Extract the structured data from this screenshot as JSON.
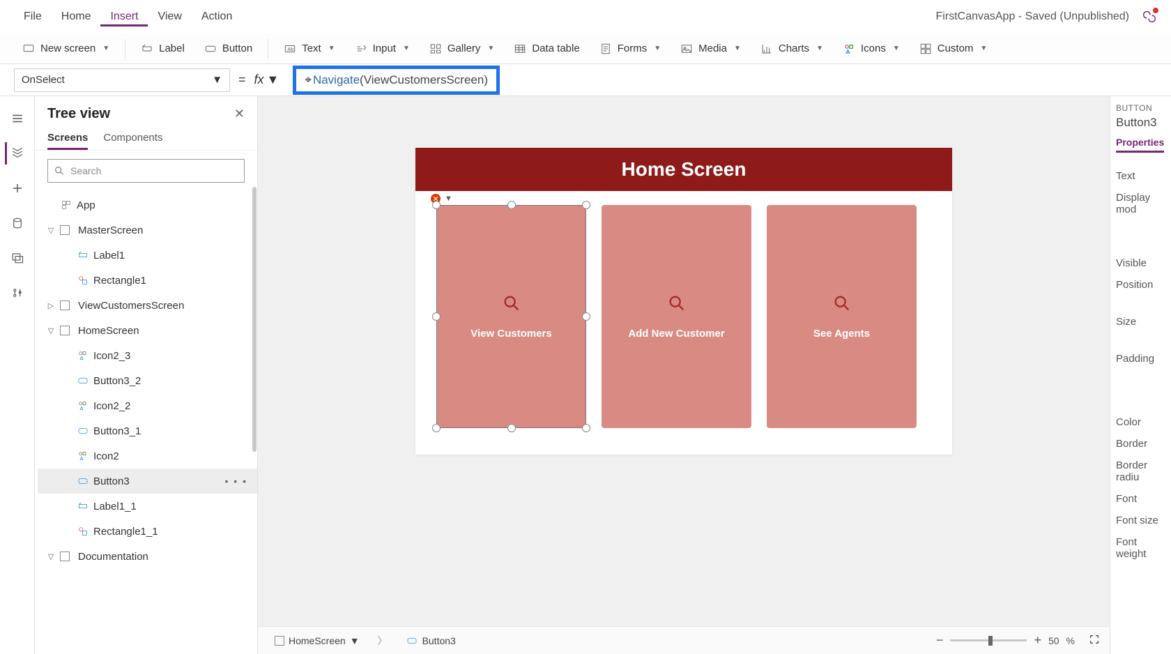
{
  "menubar": {
    "items": [
      "File",
      "Home",
      "Insert",
      "View",
      "Action"
    ],
    "active_index": 2,
    "app_status": "FirstCanvasApp - Saved (Unpublished)"
  },
  "ribbon": {
    "new_screen": "New screen",
    "label": "Label",
    "button": "Button",
    "text": "Text",
    "input": "Input",
    "gallery": "Gallery",
    "data_table": "Data table",
    "forms": "Forms",
    "media": "Media",
    "charts": "Charts",
    "icons": "Icons",
    "custom": "Custom"
  },
  "formula": {
    "property": "OnSelect",
    "equals": "=",
    "fx": "fx",
    "function_name": "Navigate",
    "open": "(",
    "argument": "ViewCustomersScreen",
    "close": ")"
  },
  "treeview": {
    "title": "Tree view",
    "tabs": [
      "Screens",
      "Components"
    ],
    "active_tab": 0,
    "search_placeholder": "Search",
    "nodes": {
      "app": "App",
      "master": "MasterScreen",
      "label1": "Label1",
      "rect1": "Rectangle1",
      "viewcust": "ViewCustomersScreen",
      "home": "HomeScreen",
      "icon2_3": "Icon2_3",
      "button3_2": "Button3_2",
      "icon2_2": "Icon2_2",
      "button3_1": "Button3_1",
      "icon2": "Icon2",
      "button3": "Button3",
      "label1_1": "Label1_1",
      "rect1_1": "Rectangle1_1",
      "doc": "Documentation"
    }
  },
  "canvas": {
    "header_title": "Home Screen",
    "cards": [
      {
        "label": "View Customers"
      },
      {
        "label": "Add New Customer"
      },
      {
        "label": "See Agents"
      }
    ],
    "breadcrumb": {
      "screen": "HomeScreen",
      "control": "Button3"
    },
    "zoom": {
      "value": "50",
      "suffix": "%"
    }
  },
  "properties": {
    "type_label": "BUTTON",
    "control_name": "Button3",
    "tab": "Properties",
    "rows": [
      "Text",
      "Display mod",
      "Visible",
      "Position",
      "Size",
      "Padding",
      "Color",
      "Border",
      "Border radiu",
      "Font",
      "Font size",
      "Font weight"
    ]
  }
}
